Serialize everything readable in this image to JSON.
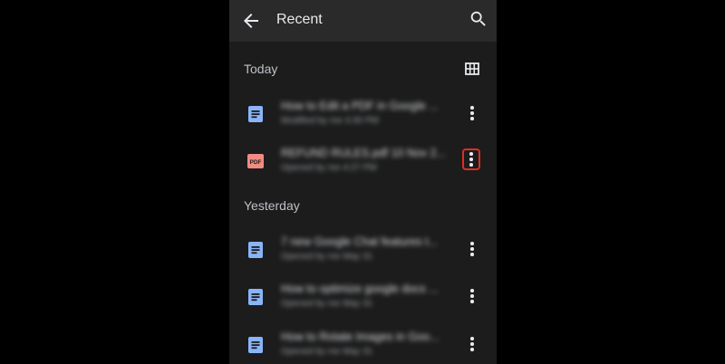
{
  "header": {
    "title": "Recent",
    "back_icon": "arrow-back-icon",
    "search_icon": "search-icon"
  },
  "sections": [
    {
      "label": "Today",
      "files": [
        {
          "type": "doc",
          "name": "How to Edit a PDF in Google ...",
          "meta": "Modified by me 4:30 PM"
        },
        {
          "type": "pdf",
          "name": "REFUND RULES.pdf 10 Nov 2...",
          "meta": "Opened by me 4:27 PM",
          "menu_highlighted": true
        }
      ]
    },
    {
      "label": "Yesterday",
      "files": [
        {
          "type": "doc",
          "name": "7 new Google Chat features t...",
          "meta": "Opened by me May 31"
        },
        {
          "type": "doc",
          "name": "How to optimize google docs ...",
          "meta": "Opened by me May 31"
        },
        {
          "type": "doc",
          "name": "How to Rotate Images in Goo...",
          "meta": "Opened by me May 31"
        }
      ]
    }
  ],
  "grid_view_icon": "grid-view-icon",
  "pdf_badge": "PDF",
  "colors": {
    "background": "#1c1c1c",
    "appbar": "#2a2a2a",
    "doc_blue": "#8ab4f8",
    "pdf_red": "#f28b82",
    "highlight": "#d93025"
  }
}
